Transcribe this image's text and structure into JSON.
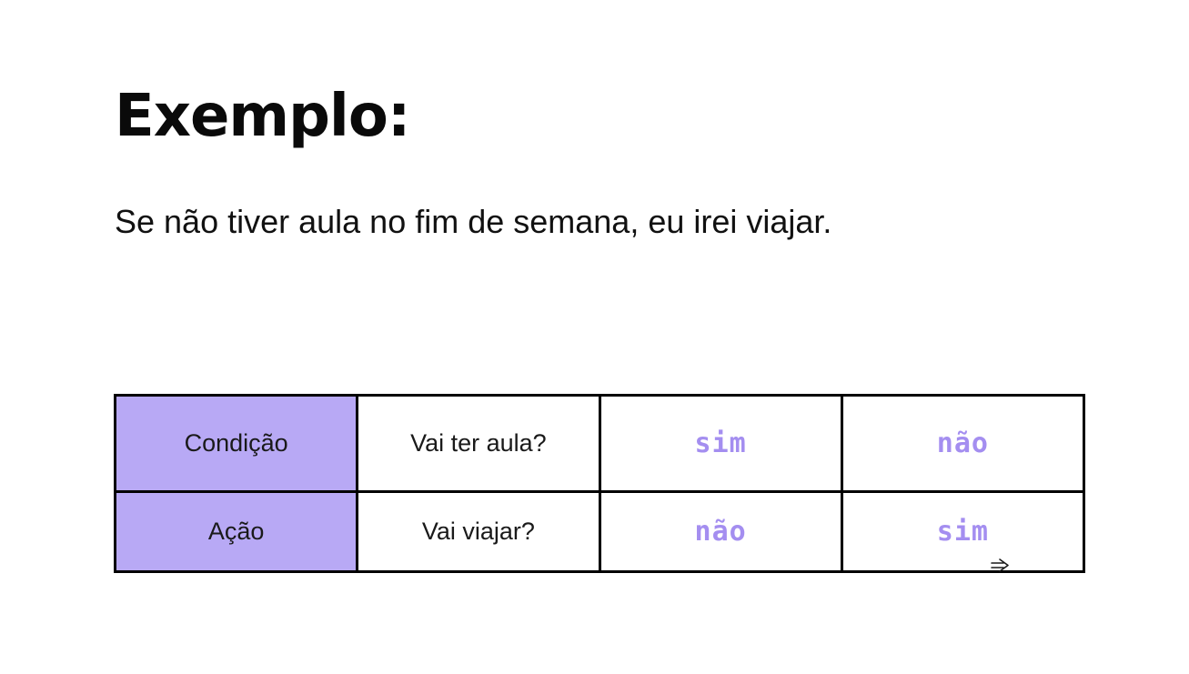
{
  "slide": {
    "title": "Exemplo:",
    "sentence": "Se não tiver aula no fim de semana, eu irei viajar."
  },
  "table": {
    "rows": [
      {
        "header": "Condição",
        "question": "Vai ter aula?",
        "values": [
          "sim",
          "não"
        ]
      },
      {
        "header": "Ação",
        "question": "Vai viajar?",
        "values": [
          "não",
          "sim"
        ]
      }
    ]
  },
  "colors": {
    "header_fill": "#b8a9f5",
    "value_text": "#a48ef0",
    "border": "#000000"
  },
  "icons": {
    "cursor": "arrow-cursor-icon"
  }
}
